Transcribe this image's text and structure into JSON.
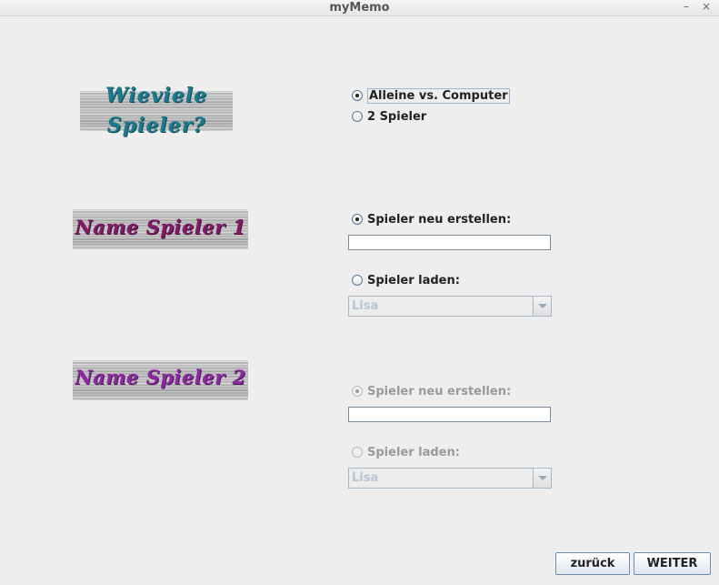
{
  "window": {
    "title": "myMemo",
    "minimize": "–",
    "close": "×"
  },
  "section_players": {
    "banner_line1": "Wieviele",
    "banner_line2": "Spieler?",
    "options": [
      {
        "label": "Alleine vs. Computer",
        "checked": true
      },
      {
        "label": "2 Spieler",
        "checked": false
      }
    ]
  },
  "player1": {
    "banner": "Name Spieler 1",
    "create_label": "Spieler neu erstellen:",
    "create_checked": true,
    "name_value": "",
    "load_label": "Spieler laden:",
    "load_checked": false,
    "load_value": "Lisa"
  },
  "player2": {
    "banner": "Name Spieler 2",
    "create_label": "Spieler neu erstellen:",
    "create_checked": true,
    "name_value": "",
    "load_label": "Spieler laden:",
    "load_checked": false,
    "load_value": "Lisa",
    "disabled": true
  },
  "buttons": {
    "back": "zurück",
    "next": "WEITER"
  }
}
